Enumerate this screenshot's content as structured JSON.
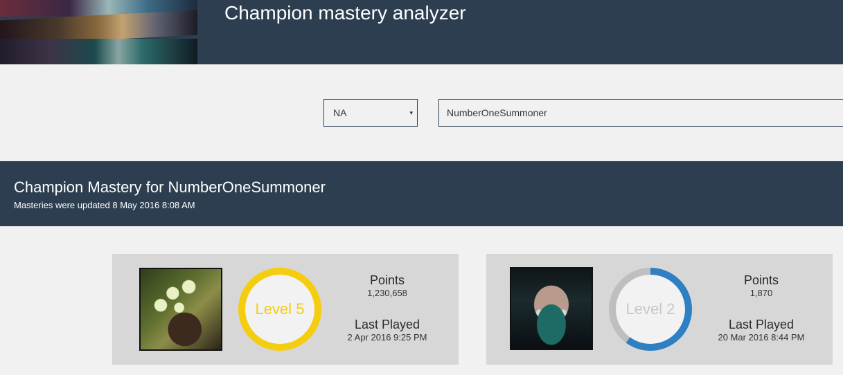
{
  "app": {
    "title": "Champion mastery analyzer"
  },
  "search": {
    "region": {
      "selected": "NA",
      "arrow": "▾"
    },
    "summoner_name": "NumberOneSummoner"
  },
  "results": {
    "title": "Champion Mastery for NumberOneSummoner",
    "subtitle": "Masteries were updated 8 May 2016 8:08 AM"
  },
  "cards": [
    {
      "champion_icon": "viktor-portrait",
      "level_label": "Level 5",
      "level_progress": 1.0,
      "ring_color": "#f5cd0f",
      "points_label": "Points",
      "points_value": "1,230,658",
      "last_played_label": "Last Played",
      "last_played_value": "2 Apr 2016 9:25 PM"
    },
    {
      "champion_icon": "akali-portrait",
      "level_label": "Level 2",
      "level_progress": 0.6,
      "ring_color": "#2f7fc3",
      "ring_track_color": "#bfbfbf",
      "points_label": "Points",
      "points_value": "1,870",
      "last_played_label": "Last Played",
      "last_played_value": "20 Mar 2016 8:44 PM"
    }
  ],
  "colors": {
    "header_bg": "#2c3e50",
    "page_bg": "#f1f1f1",
    "card_bg": "#d7d7d7"
  }
}
